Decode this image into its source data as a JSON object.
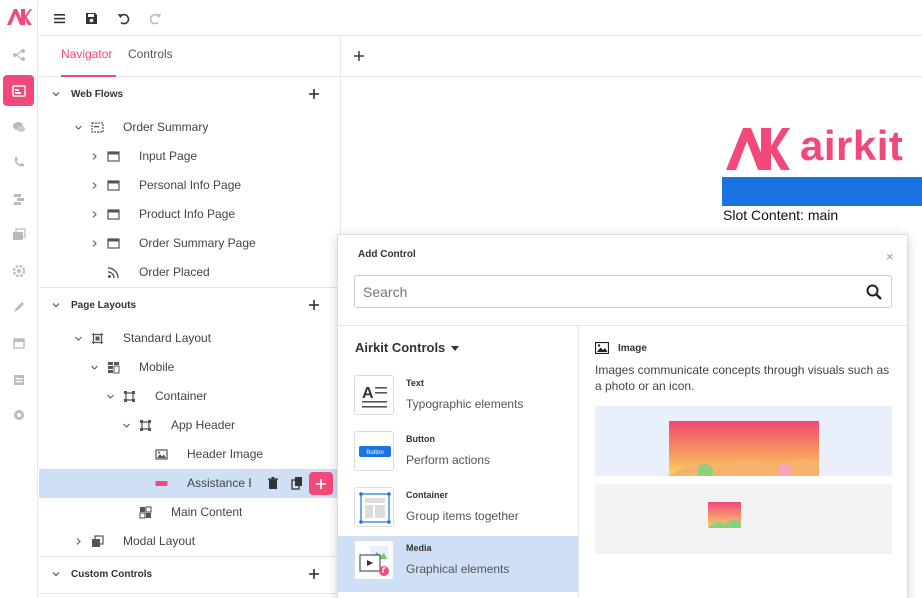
{
  "rail": {
    "items": [
      "flows-icon",
      "web-flows-icon",
      "chat-icon",
      "phone-icon",
      "data-icon",
      "media-icon",
      "settings-icon",
      "theme-icon",
      "calendar-icon",
      "table-icon",
      "integrations-icon"
    ]
  },
  "panel": {
    "tabs": [
      "Navigator",
      "Controls"
    ],
    "sections": {
      "web_flows": "Web Flows",
      "page_layouts": "Page Layouts",
      "custom_controls": "Custom Controls"
    },
    "web_flows": {
      "order_summary": "Order Summary",
      "input_page": "Input Page",
      "personal_info": "Personal Info Page",
      "product_info": "Product Info Page",
      "order_summary_page": "Order Summary Page",
      "order_placed": "Order Placed"
    },
    "page_layouts": {
      "standard_layout": "Standard Layout",
      "mobile": "Mobile",
      "container": "Container",
      "app_header": "App Header",
      "header_image": "Header Image",
      "assistance": "Assistance E",
      "main_content": "Main Content",
      "modal_layout": "Modal Layout"
    }
  },
  "preview": {
    "brand": "airkit",
    "slot_text": "Slot Content: main"
  },
  "popup": {
    "title": "Add Control",
    "close": "×",
    "search_placeholder": "Search",
    "category": "Airkit Controls",
    "controls": [
      {
        "name": "Text",
        "desc": "Typographic elements"
      },
      {
        "name": "Button",
        "desc": "Perform actions"
      },
      {
        "name": "Container",
        "desc": "Group items together"
      },
      {
        "name": "Media",
        "desc": "Graphical elements"
      }
    ],
    "button_thumb_label": "Button",
    "detail": {
      "title": "Image",
      "desc": "Images communicate concepts through visuals such as a photo or an icon."
    }
  },
  "colors": {
    "accent": "#f2487a",
    "selected_row": "#cfe0f6",
    "header_bar": "#1a73e0"
  }
}
